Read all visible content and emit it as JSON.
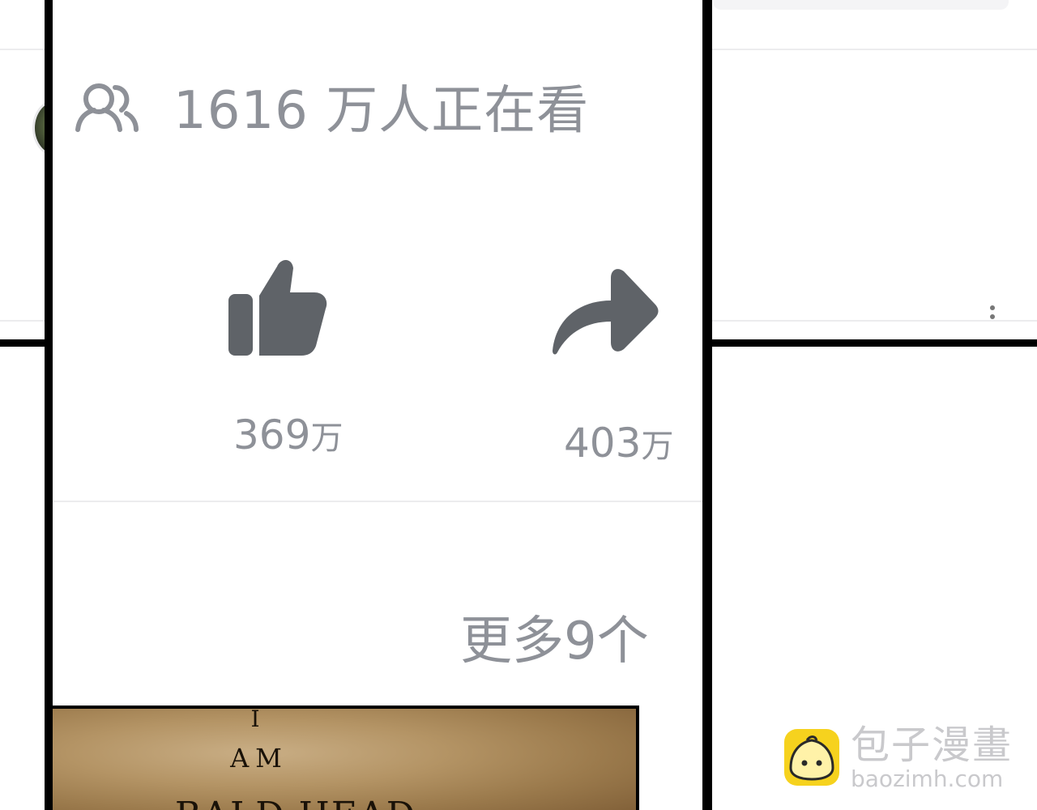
{
  "viewers": {
    "count": "1616",
    "label": "万人正在看"
  },
  "like": {
    "count": "369",
    "unit": "万"
  },
  "share": {
    "count": "403",
    "unit": "万"
  },
  "more": {
    "label": "更多9个"
  },
  "thumbnail": {
    "line1": "I",
    "line2": "AM",
    "line3": "BALD HEAD"
  },
  "watermark": {
    "name": "包子漫畫",
    "url": "baozimh.com"
  },
  "colors": {
    "text_gray": "#8e9198",
    "icon_gray": "#5f6368",
    "frame": "#000000",
    "watermark_yellow": "#f6d21e"
  }
}
